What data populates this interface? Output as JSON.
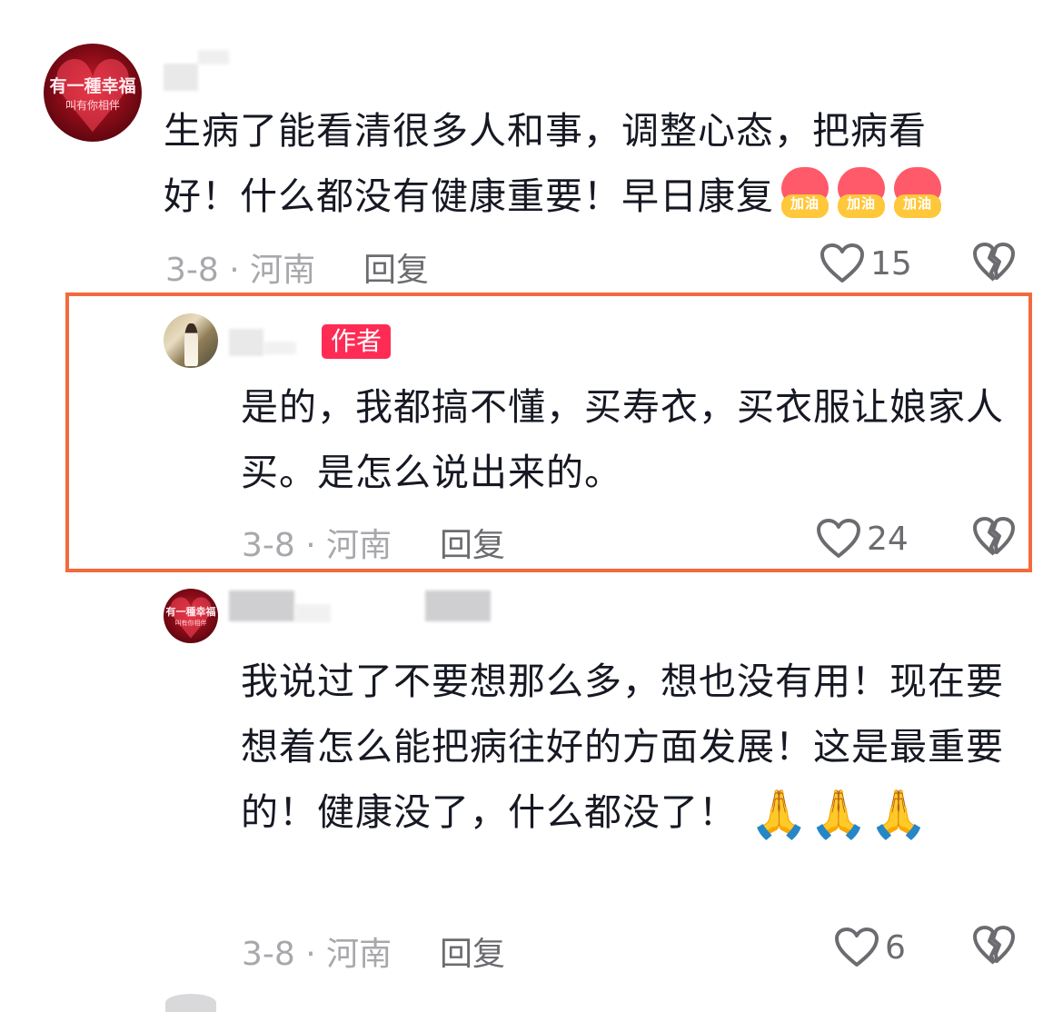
{
  "comments": [
    {
      "avatar_text_line1": "有一種幸福",
      "avatar_text_line2": "叫有你相伴",
      "text": "生病了能看清很多人和事，调整心态，把病看好！什么都没有健康重要！早日康复",
      "emojis": [
        "加油",
        "加油",
        "加油"
      ],
      "date_location": "3-8 · 河南",
      "reply_label": "回复",
      "likes": "15"
    },
    {
      "badge": "作者",
      "text": "是的，我都搞不懂，买寿衣，买衣服让娘家人买。是怎么说出来的。",
      "date_location": "3-8 · 河南",
      "reply_label": "回复",
      "likes": "24"
    },
    {
      "avatar_text_line1": "有一種幸福",
      "avatar_text_line2": "叫有你相伴",
      "text": "我说过了不要想那么多，想也没有用！现在要想着怎么能把病往好的方面发展！这是最重要的！健康没了，什么都没了！",
      "emojis": [
        "🙏",
        "🙏",
        "🙏"
      ],
      "date_location": "3-8 · 河南",
      "reply_label": "回复",
      "likes": "6"
    }
  ],
  "icons": {
    "like": "heart-outline-icon",
    "dislike": "broken-heart-icon",
    "accent_color": "#fe2c55",
    "highlight_color": "#f36a3d"
  }
}
